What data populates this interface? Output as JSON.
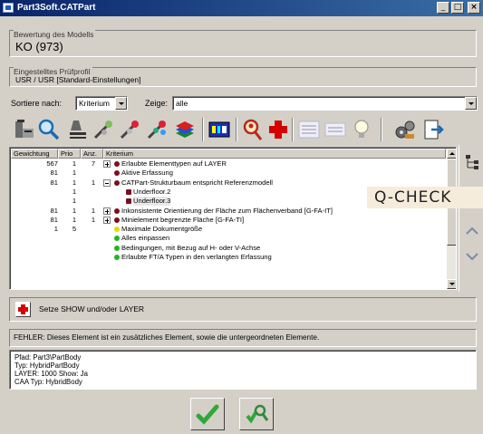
{
  "window": {
    "title": "Part3Soft.CATPart",
    "min_glyph": "_",
    "max_glyph": "□",
    "close_glyph": "×"
  },
  "model_group": {
    "legend": "Bewertung des Modells",
    "value": "KO (973)"
  },
  "profile_group": {
    "legend": "Eingestelltes Prüfprofil",
    "value": "USR / USR [Standard-Einstellungen]"
  },
  "filters": {
    "sort_label": "Sortiere nach:",
    "sort_value": "Kriterium",
    "show_label": "Zeige:",
    "show_value": "alle"
  },
  "table": {
    "headers": [
      "Gewichtung",
      "Prio",
      "Anz.",
      "Kriterium"
    ],
    "rows": [
      {
        "gewichtung": "567",
        "prio": "1",
        "anz": "7",
        "kriterium": "Erlaubte Elementtypen auf LAYER",
        "level": 0,
        "expander": "plus",
        "status": "red",
        "selected": false
      },
      {
        "gewichtung": "81",
        "prio": "1",
        "anz": "",
        "kriterium": "Aktive Erfassung",
        "level": 0,
        "expander": "none",
        "status": "red",
        "selected": false
      },
      {
        "gewichtung": "81",
        "prio": "1",
        "anz": "1",
        "kriterium": "CATPart-Strukturbaum entspricht Referenzmodell",
        "level": 0,
        "expander": "minus",
        "status": "red",
        "selected": false
      },
      {
        "gewichtung": "",
        "prio": "1",
        "anz": "",
        "kriterium": "Underfloor.2",
        "level": 1,
        "expander": "none",
        "status": "red-square",
        "selected": false
      },
      {
        "gewichtung": "",
        "prio": "1",
        "anz": "",
        "kriterium": "Underfloor.3",
        "level": 1,
        "expander": "none",
        "status": "red-square",
        "selected": true
      },
      {
        "gewichtung": "81",
        "prio": "1",
        "anz": "1",
        "kriterium": "Inkonsistente Orientierung der Fläche zum Flächenverband [G-FA-IT]",
        "level": 0,
        "expander": "plus",
        "status": "red",
        "selected": false
      },
      {
        "gewichtung": "81",
        "prio": "1",
        "anz": "1",
        "kriterium": "Minielement begrenzte Fläche [G-FA-TI]",
        "level": 0,
        "expander": "plus",
        "status": "red",
        "selected": false
      },
      {
        "gewichtung": "1",
        "prio": "5",
        "anz": "",
        "kriterium": "Maximale Dokumentgröße",
        "level": 0,
        "expander": "none",
        "status": "yellow",
        "selected": false
      },
      {
        "gewichtung": "",
        "prio": "",
        "anz": "",
        "kriterium": "Alles einpassen",
        "level": 0,
        "expander": "none",
        "status": "green",
        "selected": false
      },
      {
        "gewichtung": "",
        "prio": "",
        "anz": "",
        "kriterium": "Bedingungen, mit Bezug auf H- oder V-Achse",
        "level": 0,
        "expander": "none",
        "status": "green",
        "selected": false
      },
      {
        "gewichtung": "",
        "prio": "",
        "anz": "",
        "kriterium": "Erlaubte FT/A Typen in den verlangten Erfassung",
        "level": 0,
        "expander": "none",
        "status": "green",
        "selected": false
      }
    ]
  },
  "overlay": {
    "label": "Q-CHECK"
  },
  "action": {
    "label": "Setze SHOW und/oder LAYER"
  },
  "error": {
    "text": "FEHLER: Dieses Element ist ein zusätzliches Element, sowie die untergeordneten Elemente."
  },
  "details": {
    "lines": [
      "Pfad: Part3\\PartBody",
      "Typ: HybridPartBody",
      "LAYER: 1000    Show: Ja",
      "CAA Typ: HybridBody"
    ]
  },
  "colors": {
    "status_red": "#7a1020",
    "status_green": "#22b522",
    "status_yellow": "#e8d800",
    "title_bar": "#0a246a"
  },
  "icons": [
    "part-icon",
    "magnifier-icon",
    "sort-icon",
    "wand-icon",
    "wand-red-icon",
    "wand-multi-icon",
    "layers-icon",
    "ai-icon",
    "figure-search-icon",
    "red-cross-icon",
    "list-icon",
    "list-icon-2",
    "bulb-icon",
    "gears-icon",
    "export-icon",
    "check-icon",
    "analyze-icon"
  ]
}
